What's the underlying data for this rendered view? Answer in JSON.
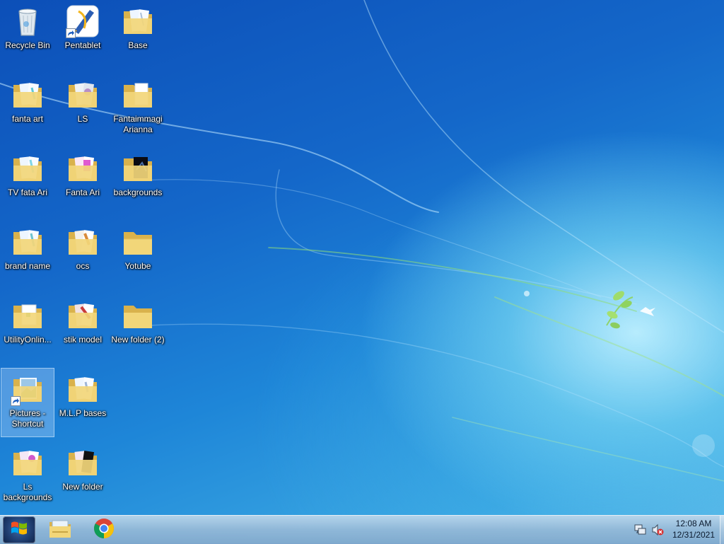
{
  "desktop": {
    "icons": [
      {
        "name": "Recycle Bin"
      },
      {
        "name": "Pentablet"
      },
      {
        "name": "Base"
      },
      {
        "name": "fanta art"
      },
      {
        "name": "LS"
      },
      {
        "name": "Fantaimmagi Arianna"
      },
      {
        "name": "TV  fata Ari"
      },
      {
        "name": "Fanta Ari"
      },
      {
        "name": "backgrounds"
      },
      {
        "name": "brand name"
      },
      {
        "name": "ocs"
      },
      {
        "name": "Yotube"
      },
      {
        "name": "UtilityOnlin..."
      },
      {
        "name": "stik  model"
      },
      {
        "name": "New folder (2)"
      },
      {
        "name": "Pictures - Shortcut"
      },
      {
        "name": "M.L.P bases"
      },
      {
        "name": "Ls backgrounds"
      },
      {
        "name": "New folder"
      }
    ]
  },
  "taskbar": {
    "start_icon": "windows-logo-icon",
    "pinned": [
      {
        "icon": "file-explorer-icon"
      },
      {
        "icon": "chrome-icon"
      }
    ],
    "tray": {
      "network_icon": "network-icon",
      "volume_icon": "volume-muted-icon",
      "time": "12:08 AM",
      "date": "12/31/2021"
    }
  },
  "colors": {
    "folder_yellow": "#f2d679",
    "folder_dark": "#d9b24c",
    "wallpaper_blue": "#1467c9",
    "selection": "#bcdcff"
  }
}
